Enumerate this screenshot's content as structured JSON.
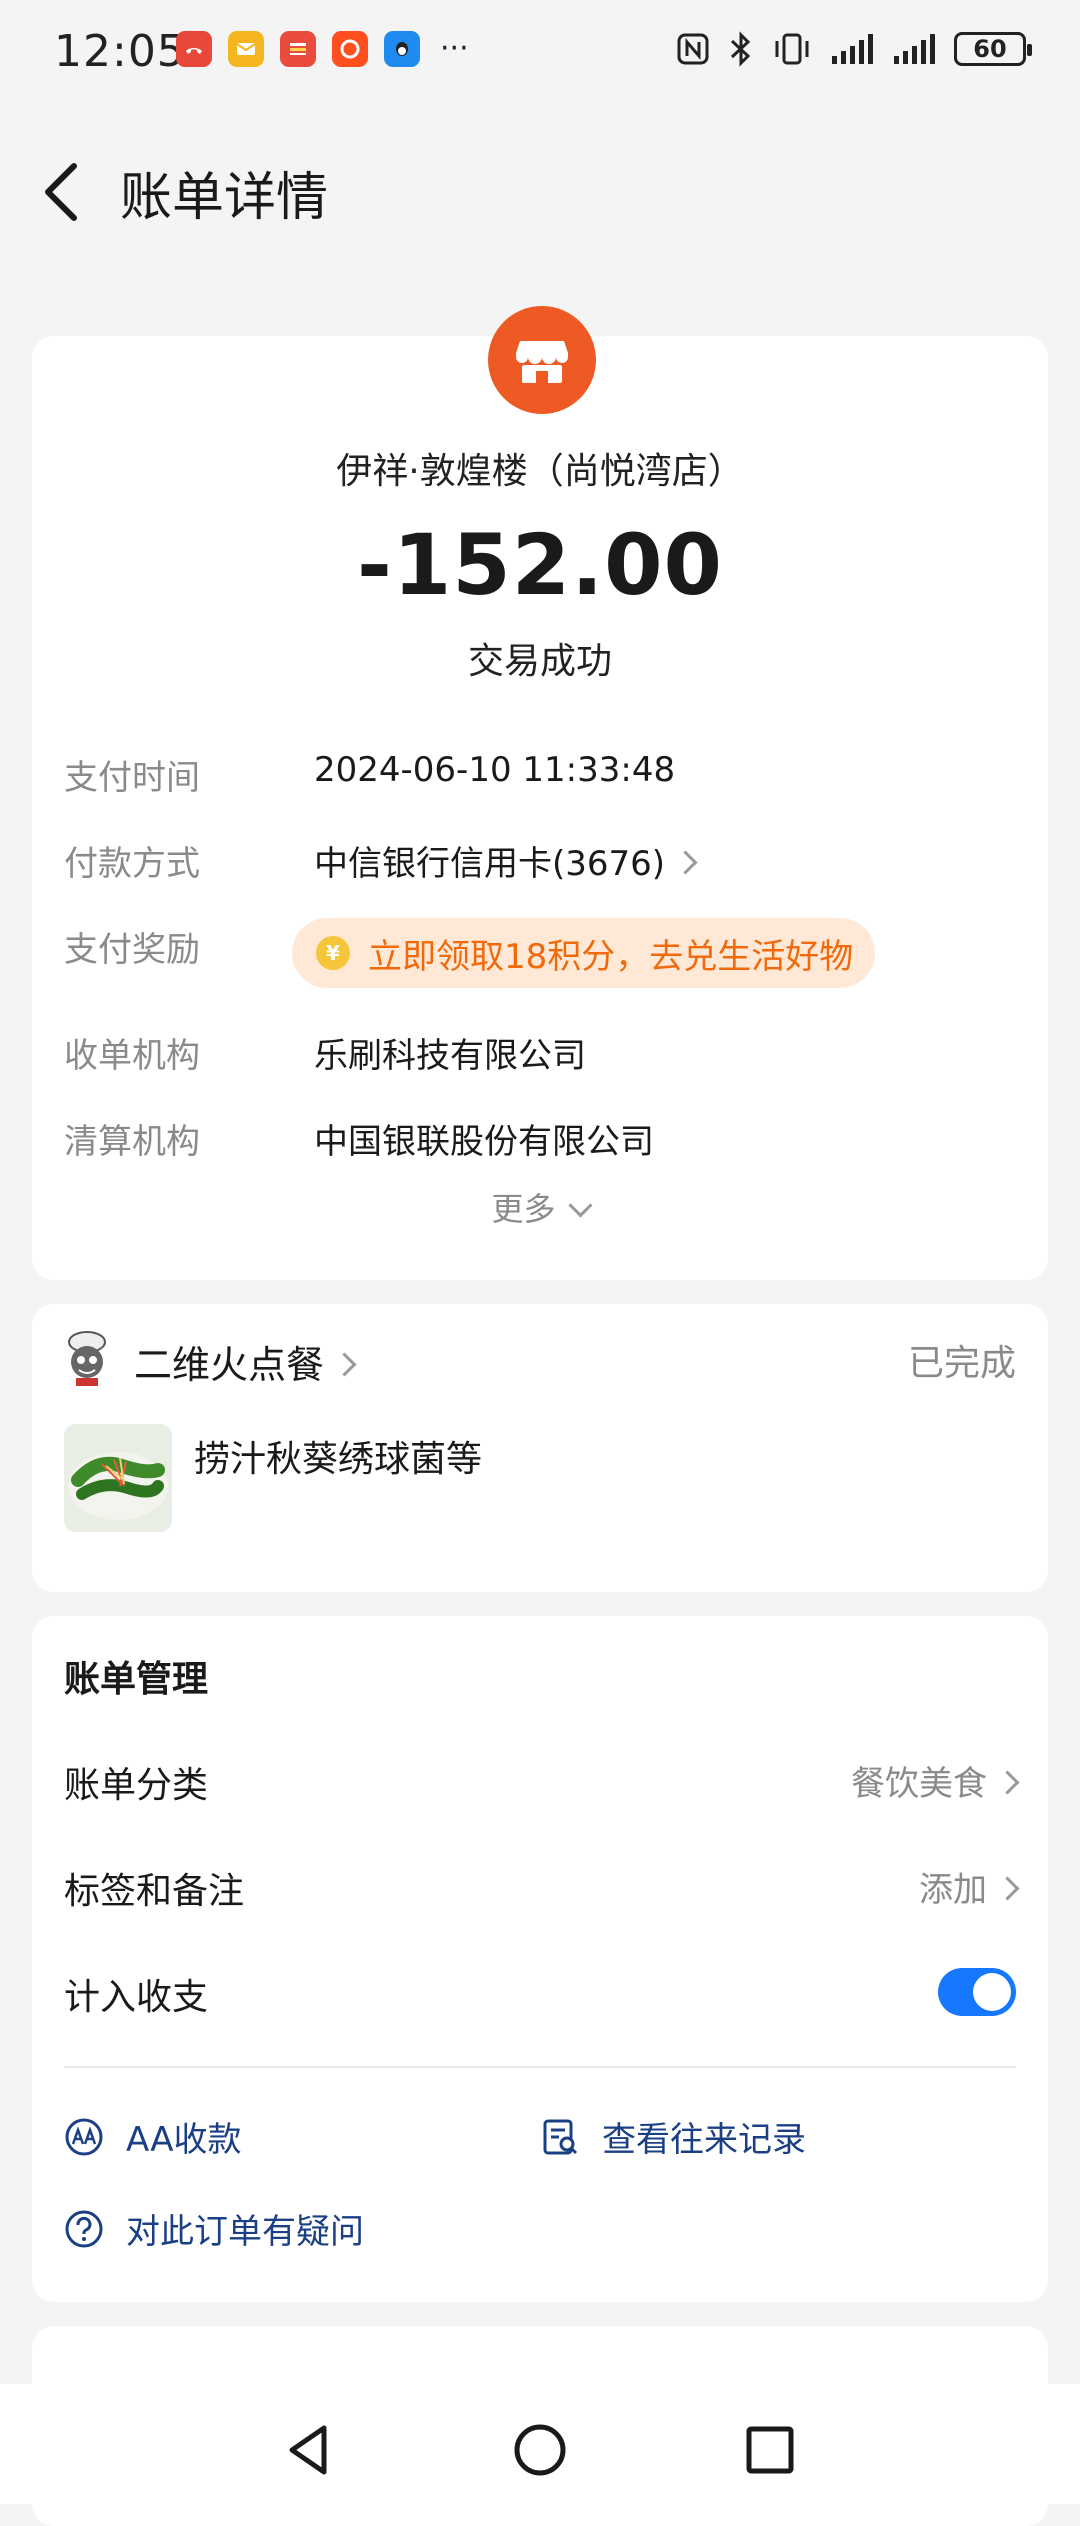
{
  "status_bar": {
    "time": "12:05",
    "more": "···",
    "battery": "60",
    "notification_icons": [
      "missed-call-icon",
      "email-icon",
      "news-icon",
      "taobao-icon",
      "qq-icon"
    ],
    "system_icons": [
      "nfc-icon",
      "bluetooth-icon",
      "vibrate-icon",
      "signal-icon",
      "signal-icon-2",
      "battery-icon"
    ]
  },
  "header": {
    "title": "账单详情"
  },
  "transaction": {
    "merchant": "伊祥·敦煌楼（尚悦湾店）",
    "amount": "-152.00",
    "status": "交易成功",
    "rows": [
      {
        "label": "支付时间",
        "value": "2024-06-10 11:33:48"
      },
      {
        "label": "付款方式",
        "value": "中信银行信用卡(3676)"
      },
      {
        "label": "支付奖励",
        "value": "立即领取18积分，去兑生活好物"
      },
      {
        "label": "收单机构",
        "value": "乐刷科技有限公司"
      },
      {
        "label": "清算机构",
        "value": "中国银联股份有限公司"
      }
    ],
    "more": "更多"
  },
  "order": {
    "service": "二维火点餐",
    "status": "已完成",
    "items": "捞汁秋葵绣球菌等"
  },
  "management": {
    "title": "账单管理",
    "category_label": "账单分类",
    "category_value": "餐饮美食",
    "tags_label": "标签和备注",
    "tags_value": "添加",
    "count_label": "计入收支",
    "count_enabled": true,
    "aa_label": "AA收款",
    "history_label": "查看往来记录",
    "question_label": "对此订单有疑问"
  },
  "colors": {
    "accent": "#1677ff",
    "merchant_logo": "#ee5a24",
    "reward_text": "#f06a0c",
    "reward_bg": "#ffe9d6",
    "link": "#1b3f84"
  }
}
